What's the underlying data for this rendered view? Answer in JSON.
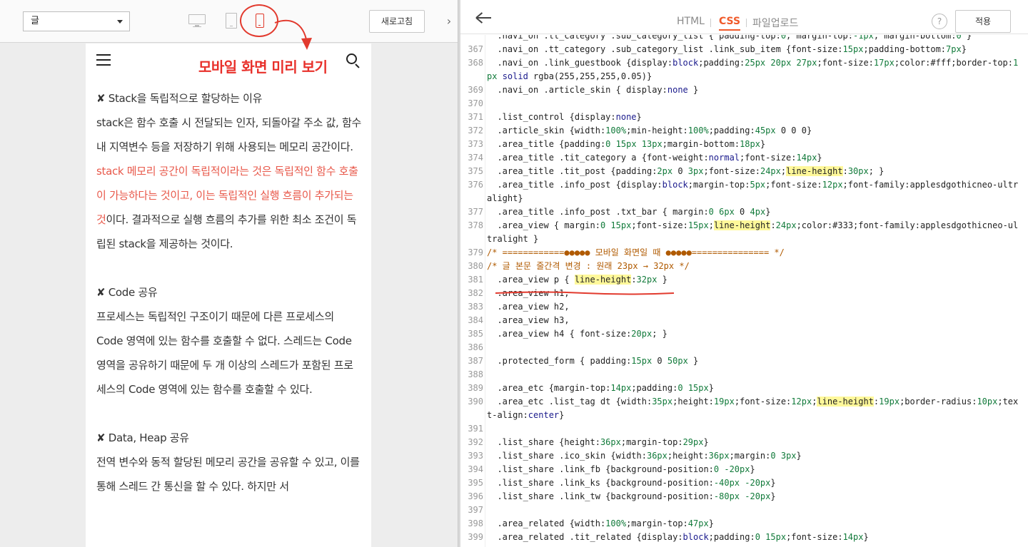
{
  "left_toolbar": {
    "skin_select_value": "글",
    "refresh_label": "새로고침",
    "collapse_symbol": "›"
  },
  "annotation": {
    "label": "모바일 화면 미리 보기",
    "color": "#e8302a"
  },
  "article": {
    "sections": [
      {
        "heading": "✘ Stack을 독립적으로 할당하는 이유",
        "body_plain_1": " stack은 함수 호출 시 전달되는 인자, 되돌아갈 주소 값, 함수 내 지역변수 등을 저장하기 위해 사용되는 메모리 공간이다. ",
        "body_red": "stack 메모리 공간이 독립적이라는 것은 독립적인 함수 호출이 가능하다는 것이고, 이는 독립적인 실행 흐름이 추가되는 것",
        "body_plain_2": "이다. 결과적으로 실행 흐름의 추가를 위한 최소 조건이 독립된 stack을 제공하는 것이다."
      },
      {
        "heading": "✘ Code 공유",
        "body": " 프로세스는 독립적인 구조이기 때문에 다른 프로세스의 Code 영역에 있는 함수를 호출할 수 없다. 스레드는 Code 영역을 공유하기 때문에 두 개 이상의 스레드가 포함된 프로세스의 Code 영역에 있는 함수를 호출할 수 있다."
      },
      {
        "heading": "✘ Data, Heap 공유",
        "body": " 전역 변수와 동적 할당된 메모리 공간을 공유할 수 있고, 이를 통해 스레드 간 통신을 할 수 있다. 하지만 서"
      }
    ]
  },
  "editor": {
    "tabs": [
      "HTML",
      "CSS",
      "파일업로드"
    ],
    "active_tab": "CSS",
    "help_label": "?",
    "apply_label": "적용",
    "accent_color": "#f05a2a"
  },
  "code_lines": [
    {
      "n": "",
      "t": "  .navi_on .tt_category .sub_category_list { padding-top:0; margin-top:-1px; margin-bottom:0 }"
    },
    {
      "n": "367",
      "t": "  .navi_on .tt_category .sub_category_list .link_sub_item {font-size:15px;padding-bottom:7px}"
    },
    {
      "n": "368",
      "t": "  .navi_on .link_guestbook {display:block;padding:25px 20px 27px;font-size:17px;color:#fff;border-top:1px solid rgba(255,255,255,0.05)}"
    },
    {
      "n": "369",
      "t": "  .navi_on .article_skin { display:none }"
    },
    {
      "n": "370",
      "t": ""
    },
    {
      "n": "371",
      "t": "  .list_control {display:none}"
    },
    {
      "n": "372",
      "t": "  .article_skin {width:100%;min-height:100%;padding:45px 0 0 0}"
    },
    {
      "n": "373",
      "t": "  .area_title {padding:0 15px 13px;margin-bottom:18px}"
    },
    {
      "n": "374",
      "t": "  .area_title .tit_category a {font-weight:normal;font-size:14px}"
    },
    {
      "n": "375",
      "t": "  .area_title .tit_post {padding:2px 0 3px;font-size:24px;line-height:30px; }"
    },
    {
      "n": "376",
      "t": "  .area_title .info_post {display:block;margin-top:5px;font-size:12px;font-family:applesdgothicneo-ultralight}"
    },
    {
      "n": "377",
      "t": "  .area_title .info_post .txt_bar { margin:0 6px 0 4px}"
    },
    {
      "n": "378",
      "t": "  .area_view { margin:0 15px;font-size:15px;line-height:24px;color:#333;font-family:applesdgothicneo-ultralight }"
    },
    {
      "n": "379",
      "t": "/* ============●●●●● 모바일 화면일 때 ●●●●●=============== */"
    },
    {
      "n": "380",
      "t": "/* 글 본문 줄간격 변경 : 원래 23px → 32px */"
    },
    {
      "n": "381",
      "t": "  .area_view p { line-height:32px }"
    },
    {
      "n": "382",
      "t": "  .area_view h1,"
    },
    {
      "n": "383",
      "t": "  .area_view h2,"
    },
    {
      "n": "384",
      "t": "  .area_view h3,"
    },
    {
      "n": "385",
      "t": "  .area_view h4 { font-size:20px; }"
    },
    {
      "n": "386",
      "t": ""
    },
    {
      "n": "387",
      "t": "  .protected_form { padding:15px 0 50px }"
    },
    {
      "n": "388",
      "t": ""
    },
    {
      "n": "389",
      "t": "  .area_etc {margin-top:14px;padding:0 15px}"
    },
    {
      "n": "390",
      "t": "  .area_etc .list_tag dt {width:35px;height:19px;font-size:12px;line-height:19px;border-radius:10px;text-align:center}"
    },
    {
      "n": "391",
      "t": ""
    },
    {
      "n": "392",
      "t": "  .list_share {height:36px;margin-top:29px}"
    },
    {
      "n": "393",
      "t": "  .list_share .ico_skin {width:36px;height:36px;margin:0 3px}"
    },
    {
      "n": "394",
      "t": "  .list_share .link_fb {background-position:0 -20px}"
    },
    {
      "n": "395",
      "t": "  .list_share .link_ks {background-position:-40px -20px}"
    },
    {
      "n": "396",
      "t": "  .list_share .link_tw {background-position:-80px -20px}"
    },
    {
      "n": "397",
      "t": ""
    },
    {
      "n": "398",
      "t": "  .area_related {width:100%;margin-top:47px}"
    },
    {
      "n": "399",
      "t": "  .area_related .tit_related {display:block;padding:0 15px;font-size:14px}"
    }
  ]
}
